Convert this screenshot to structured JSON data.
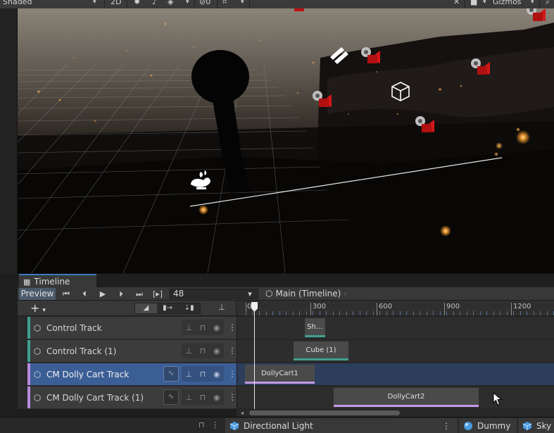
{
  "scene_toolbar": {
    "shading_mode": "Shaded",
    "view_2d_label": "2D",
    "gizmos_label": "Gizmos",
    "hidden_count": "0"
  },
  "timeline": {
    "tab_label": "Timeline",
    "preview_label": "Preview",
    "frame_value": "48",
    "keyframe_btn_label": "[▸]",
    "asset_name": "Main (Timeline)",
    "add_label": "+",
    "ruler": {
      "labels": [
        "0",
        "300",
        "600",
        "900",
        "1200"
      ]
    },
    "tracks": [
      {
        "name": "Control Track",
        "kind": "control",
        "selected": false,
        "binding": false
      },
      {
        "name": "Control Track (1)",
        "kind": "control",
        "selected": false,
        "binding": false
      },
      {
        "name": "CM Dolly Cart Track",
        "kind": "cm",
        "selected": true,
        "binding": true
      },
      {
        "name": "CM Dolly Cart Track (1)",
        "kind": "cm",
        "selected": false,
        "binding": true
      }
    ],
    "clips": [
      {
        "track": 0,
        "label": "Sh…",
        "color": "#3fa08f"
      },
      {
        "track": 1,
        "label": "Cube (1)",
        "color": "#3fa08f"
      },
      {
        "track": 2,
        "label": "DollyCart1",
        "color": "#c39ae8"
      },
      {
        "track": 3,
        "label": "DollyCart2",
        "color": "#c39ae8"
      }
    ]
  },
  "bottom_bar": {
    "panel1_label": "Directional Light",
    "panel2_label": "Dummy",
    "panel3_label": "Sky"
  },
  "colors": {
    "selection_blue": "#3b5e96",
    "control_track": "#3fa08f",
    "cm_track": "#b88ae0",
    "tab_accent": "#3a79bb"
  }
}
